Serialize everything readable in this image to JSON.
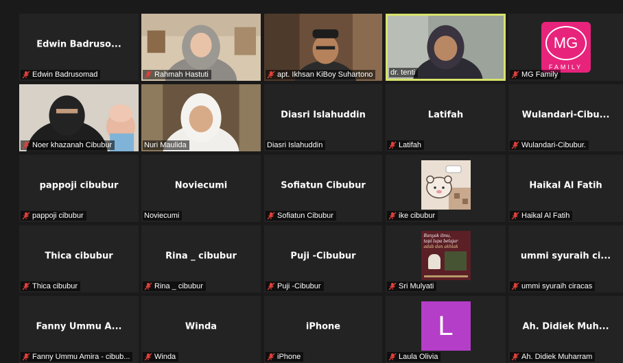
{
  "tiles": [
    {
      "center": "Edwin  Badruso...",
      "label": "Edwin Badrusomad",
      "muted": true,
      "kind": "name"
    },
    {
      "center": "",
      "label": "Rahmah Hastuti",
      "muted": true,
      "kind": "video",
      "video": "hijab-gray"
    },
    {
      "center": "",
      "label": "apt. Ikhsan KiBoy Suhartono",
      "muted": true,
      "kind": "video",
      "video": "man-cap"
    },
    {
      "center": "",
      "label": "dr. tenti",
      "muted": false,
      "kind": "video",
      "video": "hijab-dark",
      "active": true
    },
    {
      "center": "",
      "label": "MG Family",
      "muted": true,
      "kind": "logo",
      "logo_top": "MG",
      "logo_bottom": "FAMILY"
    },
    {
      "center": "",
      "label": "Noer khazanah Cibubur",
      "muted": true,
      "kind": "video",
      "video": "niqab"
    },
    {
      "center": "",
      "label": "Nuri Maulida",
      "muted": false,
      "kind": "video",
      "video": "hijab-white"
    },
    {
      "center": "Diasri Islahuddin",
      "label": "Diasri Islahuddin",
      "muted": false,
      "kind": "name"
    },
    {
      "center": "Latifah",
      "label": "Latifah",
      "muted": true,
      "kind": "name"
    },
    {
      "center": "Wulandari-Cibu...",
      "label": "Wulandari-Cibubur.",
      "muted": true,
      "kind": "name"
    },
    {
      "center": "pappoji cibubur",
      "label": "pappoji cibubur",
      "muted": true,
      "kind": "name"
    },
    {
      "center": "Noviecumi",
      "label": "Noviecumi",
      "muted": false,
      "kind": "name"
    },
    {
      "center": "Sofiatun Cibubur",
      "label": "Sofiatun Cibubur",
      "muted": true,
      "kind": "name"
    },
    {
      "center": "",
      "label": "ike cibubur",
      "muted": true,
      "kind": "thumb",
      "thumb": "bear"
    },
    {
      "center": "Haikal Al Fatih",
      "label": "Haikal Al Fatih",
      "muted": true,
      "kind": "name"
    },
    {
      "center": "Thica cibubur",
      "label": "Thica cibubur",
      "muted": true,
      "kind": "name"
    },
    {
      "center": "Rina _ cibubur",
      "label": "Rina _ cibubur",
      "muted": true,
      "kind": "name"
    },
    {
      "center": "Puji -Cibubur",
      "label": "Puji -Cibubur",
      "muted": true,
      "kind": "name"
    },
    {
      "center": "",
      "label": "Sri Mulyati",
      "muted": true,
      "kind": "thumb",
      "thumb": "poster",
      "poster_lines": [
        "Banyak ilmu,",
        "tapi lupa belajar",
        "adab dan akhlak"
      ]
    },
    {
      "center": "ummi syuraih ci...",
      "label": "ummi syuraih ciracas",
      "muted": true,
      "kind": "name"
    },
    {
      "center": "Fanny Ummu A...",
      "label": "Fanny Ummu Amira - cibub...",
      "muted": true,
      "kind": "name"
    },
    {
      "center": "Winda",
      "label": "Winda",
      "muted": true,
      "kind": "name"
    },
    {
      "center": "iPhone",
      "label": "iPhone",
      "muted": true,
      "kind": "name"
    },
    {
      "center": "",
      "label": "Laula Olivia",
      "muted": true,
      "kind": "thumb",
      "thumb": "letter",
      "letter": "L",
      "letter_color": "#b43ec8"
    },
    {
      "center": "Ah.  Didiek  Muh...",
      "label": "Ah. Didiek Muharram",
      "muted": true,
      "kind": "name"
    }
  ],
  "colors": {
    "background": "#1a1a1a",
    "tile": "#232323",
    "active_border": "#d7e36b",
    "mute_icon": "#e0403a",
    "mg_logo": "#e8237c"
  }
}
